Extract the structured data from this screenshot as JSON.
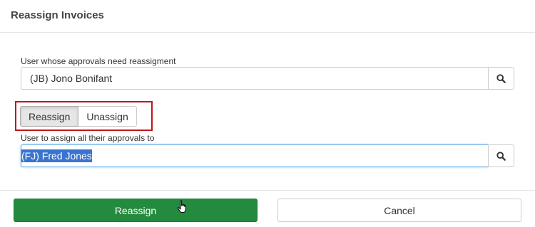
{
  "dialog": {
    "title": "Reassign Invoices"
  },
  "source_user": {
    "label": "User whose approvals need reassigment",
    "value": "(JB) Jono Bonifant",
    "search_icon": "search-icon"
  },
  "mode_toggle": {
    "options": [
      "Reassign",
      "Unassign"
    ],
    "selected": "Reassign",
    "highlight_color": "#c0151c"
  },
  "target_user": {
    "label": "User to assign all their approvals to",
    "value": "(FJ) Fred Jones",
    "search_icon": "search-icon"
  },
  "footer": {
    "primary_label": "Reassign",
    "secondary_label": "Cancel",
    "primary_color": "#248a3d"
  }
}
